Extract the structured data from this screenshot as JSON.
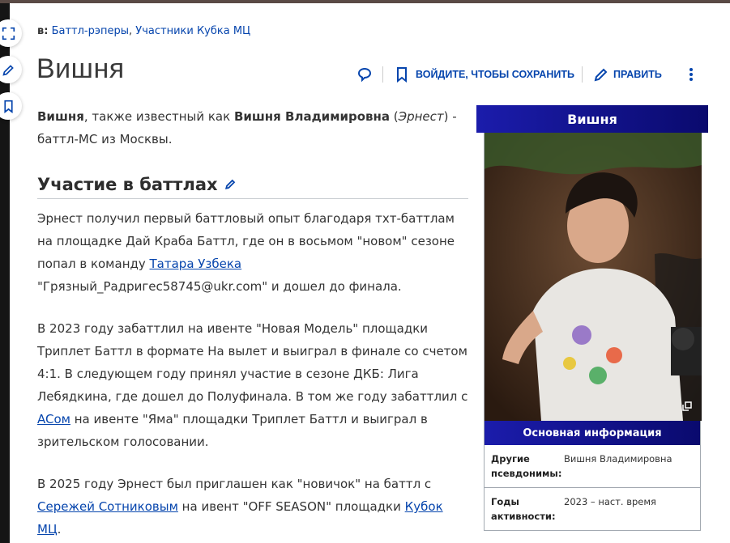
{
  "categories": {
    "prefix": "в:",
    "items": [
      "Баттл-рэперы",
      "Участники Кубка МЦ"
    ]
  },
  "page_title": "Вишня",
  "toolbar": {
    "save_label": "ВОЙДИТЕ, ЧТОБЫ СОХРАНИТЬ",
    "edit_label": "ПРАВИТЬ"
  },
  "intro": {
    "name": "Вишня",
    "text1": ", также известный как ",
    "alias": "Вишня Владимировна",
    "text2": " (",
    "real_name": "Эрнест",
    "text3": ") - баттл-МС из Москвы."
  },
  "section": {
    "title": "Участие в баттлах"
  },
  "para1": {
    "text1": "Эрнест получил первый баттловый опыт благодаря тхт-баттлам на площадке Дай Краба Баттл, где он в восьмом \"новом\" сезоне попал в команду ",
    "link1": "Татара Узбека",
    "text2": " \"Грязный_Радригес58745@ukr.com\" и дошел до финала."
  },
  "para2": {
    "text1": "В 2023 году забаттлил на ивенте \"Новая Модель\" площадки Триплет Баттл в формате На вылет и выиграл в финале со счетом 4:1. В следующем году принял участие в сезоне ДКБ: Лига Лебядкина, где дошел до Полуфинала. В том же году забаттлил с ",
    "link1": "ACом",
    "text2": " на ивенте \"Яма\" площадки Триплет Баттл и выиграл в зрительском голосовании."
  },
  "para3": {
    "text1": "В 2025 году Эрнест был приглашен как \"новичок\" на баттл с ",
    "link1": "Сережей Сотниковым",
    "text2": " на ивент \"OFF SEASON\" площадки ",
    "link2": "Кубок МЦ",
    "text3": "."
  },
  "infobox": {
    "title": "Вишня",
    "subtitle": "Основная информация",
    "rows": [
      {
        "label": "Другие псевдонимы:",
        "value": "Вишня Владимировна"
      },
      {
        "label": "Годы активности:",
        "value": "2023 – наст. время"
      }
    ]
  },
  "icons": [
    "expand-icon",
    "pencil-icon",
    "bookmark-icon",
    "comment-icon",
    "more-icon",
    "enlarge-icon"
  ],
  "colors": {
    "link": "#0645ad",
    "infobox_header_start": "#1b1cab",
    "infobox_header_end": "#0a0a6e"
  }
}
